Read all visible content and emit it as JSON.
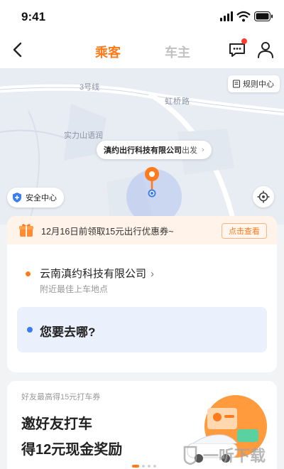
{
  "status_bar": {
    "time": "9:41",
    "icons": [
      "cellular-signal-icon",
      "wifi-icon",
      "battery-icon"
    ]
  },
  "nav": {
    "tabs": [
      {
        "label": "乘客",
        "active": true
      },
      {
        "label": "车主",
        "active": false
      }
    ],
    "icons": [
      "back-icon",
      "message-icon",
      "user-icon"
    ]
  },
  "map": {
    "labels": {
      "line3": "3号线",
      "road": "虹桥路",
      "hill": "实力山语润"
    },
    "rules_label": "规则中心",
    "pickup_bubble": {
      "place": "滇约出行科技有限公司",
      "suffix": "出发"
    },
    "safety_label": "安全中心"
  },
  "coupon": {
    "text": "12月16日前领取15元出行优惠券~",
    "button": "点击查看"
  },
  "route": {
    "pickup_name": "云南滇约科技有限公司",
    "pickup_hint": "附近最佳上车地点",
    "destination_placeholder": "您要去哪?"
  },
  "promo": {
    "subtitle": "好友最高得15元打车券",
    "title_line1": "邀好友打车",
    "title_line2": "得12元现金奖励",
    "page_count": 4,
    "active_page": 1
  },
  "watermark": "一听下载",
  "colors": {
    "accent": "#ff7a1a",
    "blue": "#3a7df0",
    "coupon_bg": "#fff3ea",
    "dest_bg": "#eaf1fd"
  }
}
